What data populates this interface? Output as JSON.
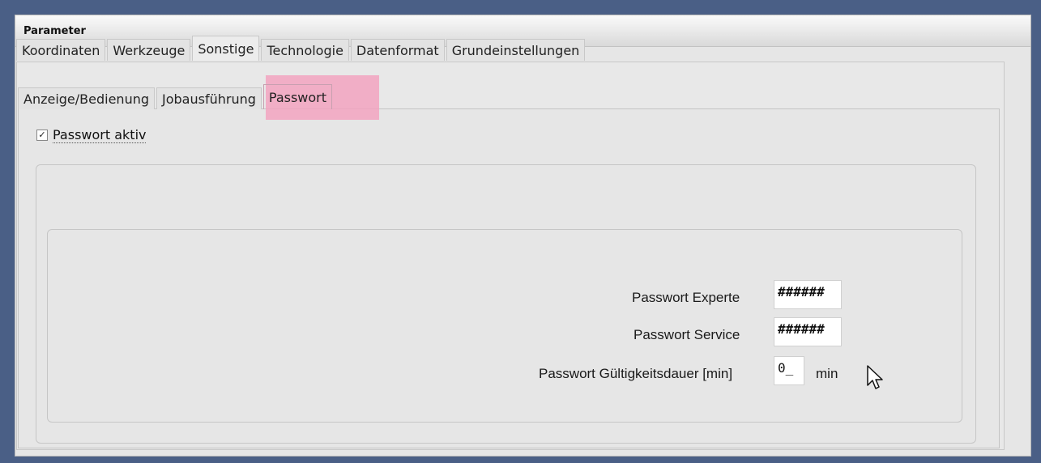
{
  "window": {
    "title": "Parameter"
  },
  "tabs": [
    {
      "label": "Koordinaten"
    },
    {
      "label": "Werkzeuge"
    },
    {
      "label": "Sonstige"
    },
    {
      "label": "Technologie"
    },
    {
      "label": "Datenformat"
    },
    {
      "label": "Grundeinstellungen"
    }
  ],
  "subtabs": [
    {
      "label": "Anzeige/Bedienung"
    },
    {
      "label": "Jobausführung"
    },
    {
      "label": "Passwort"
    }
  ],
  "password_active": {
    "label": "Passwort aktiv",
    "checked": true,
    "check_glyph": "✓"
  },
  "fields": {
    "expert": {
      "label": "Passwort Experte",
      "value": "######"
    },
    "service": {
      "label": "Passwort Service",
      "value": "######"
    },
    "validity": {
      "label": "Passwort Gültigkeitsdauer [min]",
      "value": "0_",
      "unit": "min"
    }
  },
  "icons": {
    "cursor": "mouse-pointer-icon"
  }
}
